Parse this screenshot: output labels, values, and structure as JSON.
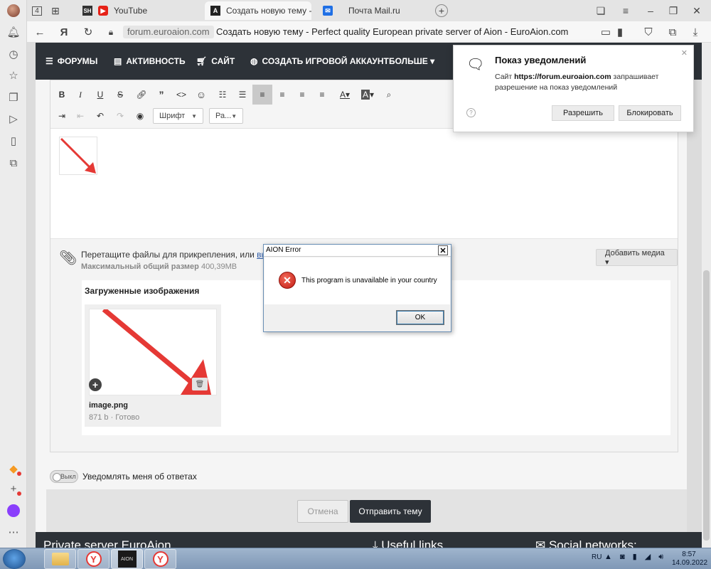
{
  "browser": {
    "tabs": [
      {
        "label": "YouTube",
        "favicon": "youtube-icon"
      },
      {
        "label": "Создать новую тему - P",
        "favicon": "euroaion-icon"
      },
      {
        "label": "Почта Mail.ru",
        "favicon": "mail-icon"
      }
    ],
    "tab_counter": "4",
    "address": {
      "domain": "forum.euroaion.com",
      "page_title": "Создать новую тему - Perfect quality European private server of Aion - EuroAion.com"
    }
  },
  "site_nav": {
    "items": [
      {
        "label": "ФОРУМЫ",
        "icon": "forums-icon"
      },
      {
        "label": "АКТИВНОСТЬ",
        "icon": "activity-icon"
      },
      {
        "label": "САЙТ",
        "icon": "cart-icon"
      },
      {
        "label": "СОЗДАТЬ ИГРОВОЙ АККАУНТ",
        "icon": "globe-icon"
      },
      {
        "label": "БОЛЬШЕ ▾",
        "icon": ""
      }
    ]
  },
  "editor": {
    "font_select": "Шрифт",
    "size_select": "Ра..."
  },
  "attachments": {
    "hint": "Перетащите файлы для прикрепления, или ",
    "hint_link": "выбер",
    "limit_label": "Максимальный общий размер",
    "limit_value": "400,39MB",
    "add_media": "Добавить медиа ▾",
    "uploaded_title": "Загруженные изображения",
    "file": {
      "name": "image.png",
      "meta": "871 b · Готово"
    }
  },
  "notify": {
    "toggle_text": "Выкл",
    "label": "Уведомлять меня об ответах"
  },
  "actions": {
    "cancel": "Отмена",
    "submit": "Отправить тему"
  },
  "footer": {
    "col1": "Private server EuroAion",
    "col2": "Useful links",
    "col3": "Social networks:"
  },
  "permission_popup": {
    "title": "Показ уведомлений",
    "text_prefix": "Сайт ",
    "site": "https://forum.euroaion.com",
    "text_suffix": " запрашивает разрешение на показ уведомлений",
    "allow": "Разрешить",
    "block": "Блокировать"
  },
  "error_dialog": {
    "title": "AION Error",
    "message": "This program is unavailable in your country",
    "ok": "OK"
  },
  "taskbar": {
    "lang": "RU",
    "time": "8:57",
    "date": "14.09.2022",
    "aion_label": "AION"
  },
  "colors": {
    "nav_bg": "#2d3238",
    "arrow_red": "#e53935",
    "link_blue": "#2b59a6"
  }
}
